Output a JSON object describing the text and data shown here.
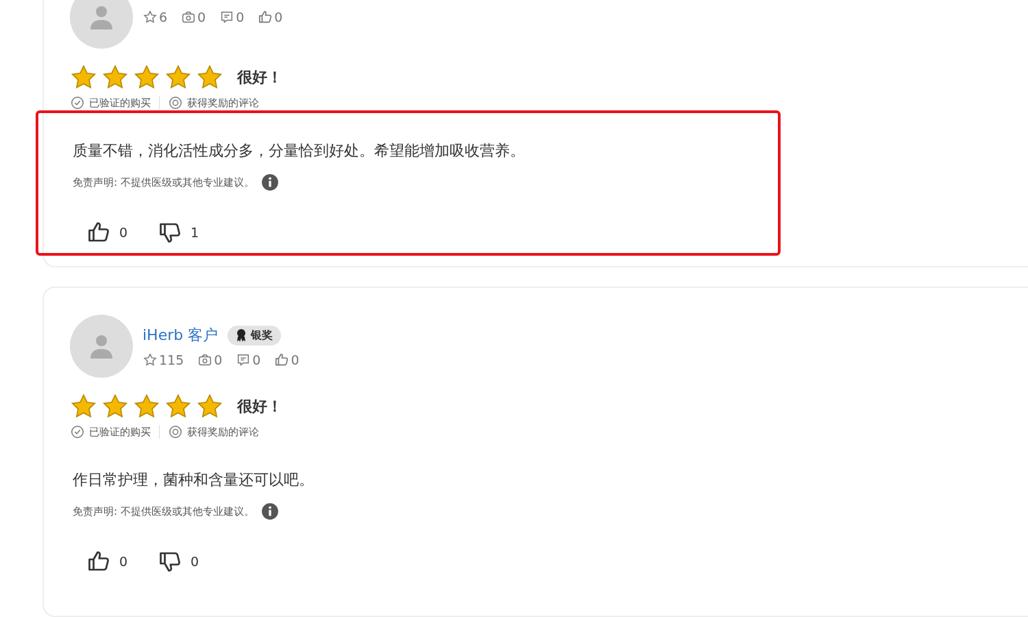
{
  "reviews": [
    {
      "stats": {
        "points": "6",
        "photos": "0",
        "comments": "0",
        "likes": "0"
      },
      "stars": 5,
      "title": "很好！",
      "tags": [
        "已验证的购买",
        "获得奖励的评论"
      ],
      "text": "质量不错，消化活性成分多，分量恰到好处。希望能增加吸收营养。",
      "disclaimer": "免责声明: 不提供医级或其他专业建议。",
      "helpful": "0",
      "unhelpful": "1",
      "highlighted": true
    },
    {
      "name": "iHerb 客户",
      "badge": "银奖",
      "stats": {
        "points": "115",
        "photos": "0",
        "comments": "0",
        "likes": "0"
      },
      "stars": 5,
      "title": "很好！",
      "tags": [
        "已验证的购买",
        "获得奖励的评论"
      ],
      "text": "作日常护理，菌种和含量还可以吧。",
      "disclaimer": "免责声明: 不提供医级或其他专业建议。",
      "helpful": "0",
      "unhelpful": "0",
      "highlighted": false
    }
  ]
}
